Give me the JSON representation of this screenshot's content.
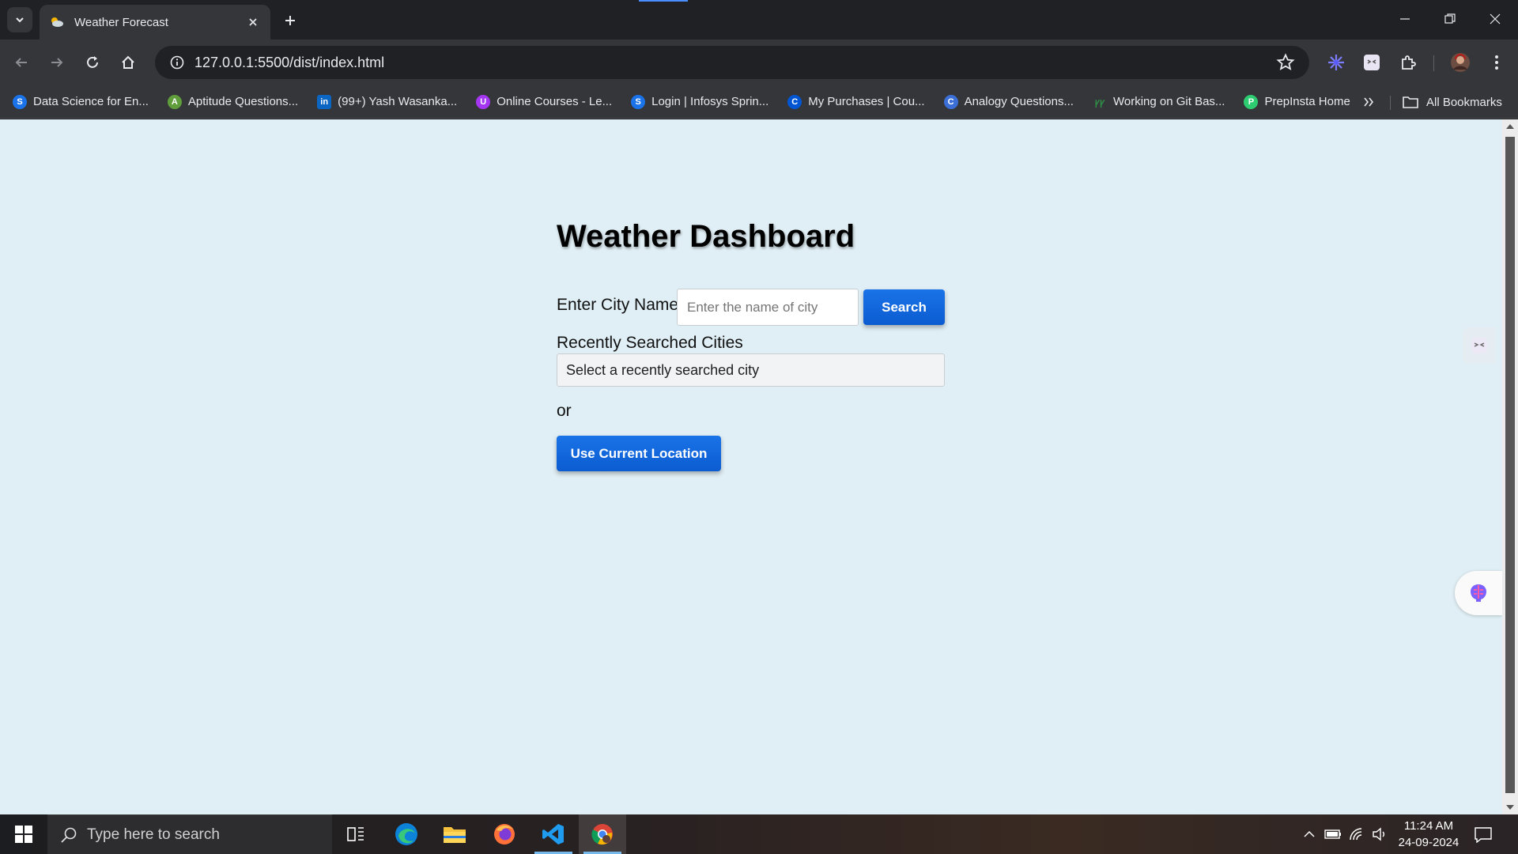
{
  "browser": {
    "tab_title": "Weather Forecast",
    "url": "127.0.0.1:5500/dist/index.html",
    "bookmarks": [
      {
        "label": "Data Science for En...",
        "color": "#1a73e8",
        "glyph": "S"
      },
      {
        "label": "Aptitude Questions...",
        "color": "#5f9e3a",
        "glyph": "A"
      },
      {
        "label": "(99+) Yash Wasanka...",
        "color": "#0a66c2",
        "glyph": "in"
      },
      {
        "label": "Online Courses - Le...",
        "color": "#a435f0",
        "glyph": "U"
      },
      {
        "label": "Login | Infosys Sprin...",
        "color": "#1a73e8",
        "glyph": "S"
      },
      {
        "label": "My Purchases | Cou...",
        "color": "#0056d2",
        "glyph": "C"
      },
      {
        "label": "Analogy Questions...",
        "color": "#3b6fd6",
        "glyph": "C"
      },
      {
        "label": "Working on Git Bas...",
        "color": "#2f8d46",
        "glyph": "G"
      },
      {
        "label": "PrepInsta Home",
        "color": "#2ecc71",
        "glyph": "P"
      }
    ],
    "all_bookmarks_label": "All Bookmarks"
  },
  "page": {
    "title": "Weather Dashboard",
    "city_label": "Enter City Name",
    "city_placeholder": "Enter the name of city",
    "search_button": "Search",
    "recent_label": "Recently Searched Cities",
    "recent_select_value": "Select a recently searched city",
    "or_text": "or",
    "location_button": "Use Current Location",
    "accent_color": "#1a73e8",
    "background_color": "#e0eff5"
  },
  "taskbar": {
    "search_placeholder": "Type here to search",
    "time": "11:24 AM",
    "date": "24-09-2024"
  }
}
